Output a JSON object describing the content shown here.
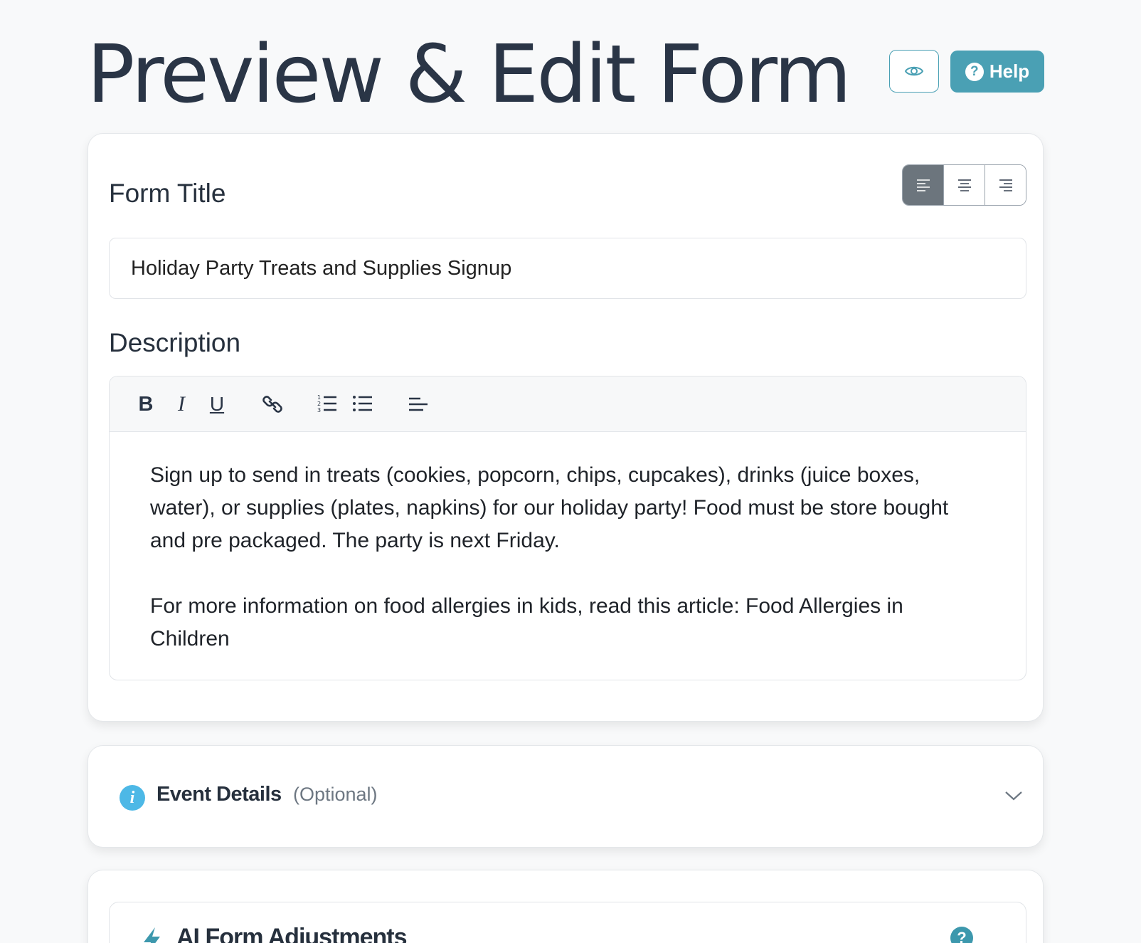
{
  "header": {
    "title": "Preview & Edit Form",
    "preview_icon": "eye-icon",
    "help_label": "Help",
    "help_icon": "question-circle-icon"
  },
  "form": {
    "title_label": "Form Title",
    "title_value": "Holiday Party Treats and Supplies Signup",
    "alignment_options": [
      "align-left",
      "align-center",
      "align-right"
    ],
    "alignment_selected": "align-left",
    "description_label": "Description",
    "toolbar": {
      "bold": "B",
      "italic": "I",
      "underline": "U",
      "link_icon": "link-icon",
      "ordered_list_icon": "ordered-list-icon",
      "unordered_list_icon": "unordered-list-icon",
      "align_icon": "align-left-icon"
    },
    "description_paragraphs": [
      "Sign up to send in treats (cookies, popcorn, chips, cupcakes), drinks (juice boxes, water), or supplies (plates, napkins) for our holiday party! Food must be store bought and pre packaged. The party is next Friday.",
      "For more information on food allergies in kids, read this article: Food Allergies in Children"
    ]
  },
  "event_details": {
    "title": "Event Details",
    "optional_label": "(Optional)",
    "icon": "info-icon",
    "expand_icon": "chevron-down-icon"
  },
  "ai_adjustments": {
    "title": "AI Form Adjustments",
    "icon": "lightning-icon",
    "help_icon": "question-circle-icon",
    "help_glyph": "?"
  },
  "colors": {
    "accent": "#4aa0b4",
    "title_text": "#2a3546",
    "info_blue": "#4db8e6",
    "active_align": "#6c757d"
  }
}
